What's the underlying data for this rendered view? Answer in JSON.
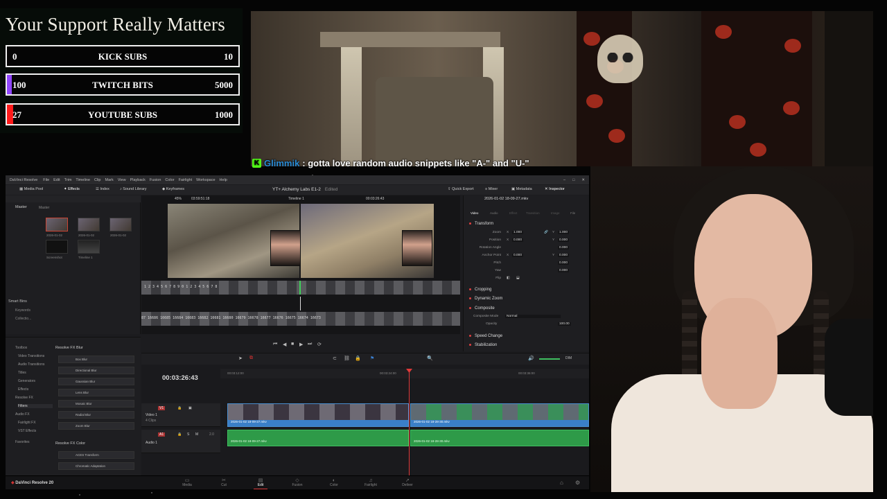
{
  "goals": {
    "title": "Your Support Really Matters",
    "bars": [
      {
        "start": "0",
        "name": "KICK SUBS",
        "end": "10",
        "progress": 0.0,
        "color": "#53fc18"
      },
      {
        "start": "100",
        "name": "TWITCH BITS",
        "end": "5000",
        "progress": 0.02,
        "color": "#9146ff"
      },
      {
        "start": "27",
        "name": "YOUTUBE SUBS",
        "end": "1000",
        "progress": 0.027,
        "color": "#ff1a1a"
      }
    ]
  },
  "chat": {
    "platform_icon": "K",
    "user": "Glimmik",
    "message": ": gotta love random audio snippets like \"A-\" and \"U-\""
  },
  "resolve": {
    "title_bar": {
      "app": "DaVinci Resolve",
      "menu": [
        "File",
        "Edit",
        "Trim",
        "Timeline",
        "Clip",
        "Mark",
        "View",
        "Playback",
        "Fusion",
        "Color",
        "Fairlight",
        "Workspace",
        "Help"
      ]
    },
    "toolbar": {
      "media_pool": "Media Pool",
      "effects": "Effects",
      "index": "Index",
      "sound_library": "Sound Library",
      "keyframes": "Keyframes",
      "project": "YT+ Alchemy Labs E1-2",
      "edited": "Edited",
      "quick_export": "Quick Export",
      "mixer": "Mixer",
      "metadata": "Metadata",
      "inspector": "Inspector"
    },
    "media_pool": {
      "master_tab": "Master",
      "bin": "Master",
      "clips": [
        {
          "name": "2026-01-02"
        },
        {
          "name": "2026-01-02"
        },
        {
          "name": "2026-01-02"
        },
        {
          "name": "Screenshot"
        },
        {
          "name": "Timeline 1"
        }
      ],
      "smart_bins": "Smart Bins",
      "smart_items": [
        "Keywords",
        "Collectio..."
      ]
    },
    "viewer": {
      "zoom": "45%",
      "source_tc": "03:59:51:18",
      "timeline_name": "Timeline 1",
      "record_tc": "00:03:26:43",
      "strip_top": "1   2   3   4   5   6   7   8   9   0   1   2   3   4   5   6   7   8",
      "strip_bottom": "87 16686 16685 16684 16683 16682 16681 16680 16679 16678 16677 16676 16675 16674 16673"
    },
    "inspector": {
      "clip_name": "2026-01-02 18-09-27.mkv",
      "tabs": [
        "Video",
        "Audio",
        "Effect",
        "Transition",
        "Image",
        "File"
      ],
      "transform": "Transform",
      "rows": [
        {
          "label": "Zoom",
          "x_label": "X",
          "x": "1.000",
          "y_label": "Y",
          "y": "1.000"
        },
        {
          "label": "Position",
          "x_label": "X",
          "x": "0.000",
          "y_label": "Y",
          "y": "0.000"
        },
        {
          "label": "Rotation Angle",
          "value": "0.000"
        },
        {
          "label": "Anchor Point",
          "x_label": "X",
          "x": "0.000",
          "y_label": "Y",
          "y": "0.000"
        },
        {
          "label": "Pitch",
          "value": "0.000"
        },
        {
          "label": "Yaw",
          "value": "0.000"
        },
        {
          "label": "Flip",
          "value": ""
        }
      ],
      "cropping": "Cropping",
      "dynamic_zoom": "Dynamic Zoom",
      "composite": "Composite",
      "composite_mode_label": "Composite Mode",
      "composite_mode": "Normal",
      "opacity_label": "Opacity",
      "opacity": "100.00",
      "speed_change": "Speed Change",
      "stabilization": "Stabilization"
    },
    "effects": {
      "tree": [
        "Toolbox",
        "Video Transitions",
        "Audio Transitions",
        "Titles",
        "Generators",
        "Effects",
        "Resolve FX",
        "Filters",
        "Audio FX",
        "Fairlight FX",
        "VST Effects",
        "Favorites"
      ],
      "section1": "Resolve FX Blur",
      "blur_items": [
        "Box Blur",
        "Directional Blur",
        "Gaussian Blur",
        "Lens Blur",
        "Mosaic Blur",
        "Radial Blur",
        "Zoom Blur"
      ],
      "section2": "Resolve FX Color",
      "color_items": [
        "ACES Transform",
        "Chromatic Adaptation"
      ]
    },
    "timeline": {
      "timecode": "00:03:26:43",
      "ruler": [
        "00:03:12:00",
        "00:03:24:00",
        "00:03:36:00"
      ],
      "v1": {
        "tag": "V1",
        "name": "Video 1",
        "count": "4 Clips"
      },
      "a1": {
        "tag": "A1",
        "name": "Audio 1",
        "level": "2.0"
      },
      "clips": {
        "video_a": "2026-01-02 18-09-27.mkv",
        "video_b": "2026-01-02 18-28-30.mkv",
        "audio_a": "2026-01-02 18-09-27.mkv",
        "audio_b": "2026-01-02 18-28-30.mkv"
      },
      "dim": "DIM"
    },
    "pages": {
      "brand": "DaVinci Resolve 20",
      "items": [
        {
          "label": "Media",
          "icon": "▭"
        },
        {
          "label": "Cut",
          "icon": "✂"
        },
        {
          "label": "Edit",
          "icon": "▤"
        },
        {
          "label": "Fusion",
          "icon": "◇"
        },
        {
          "label": "Color",
          "icon": "◐"
        },
        {
          "label": "Fairlight",
          "icon": "♫"
        },
        {
          "label": "Deliver",
          "icon": "➚"
        }
      ],
      "active": "Edit"
    }
  }
}
